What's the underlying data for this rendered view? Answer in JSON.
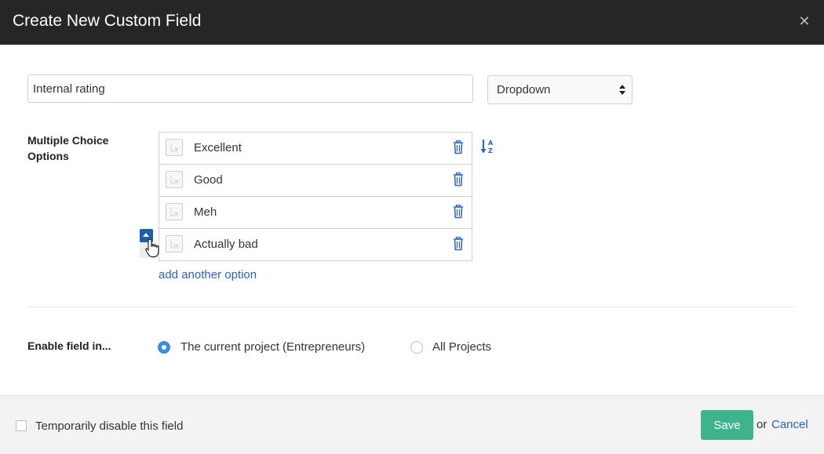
{
  "modal": {
    "title": "Create New Custom Field",
    "close_icon": "close-icon",
    "close_glyph": "✕"
  },
  "field": {
    "name_value": "Internal rating",
    "type_selected": "Dropdown"
  },
  "options_section": {
    "label": "Multiple Choice Options",
    "options": [
      {
        "label": "Excellent"
      },
      {
        "label": "Good"
      },
      {
        "label": "Meh"
      },
      {
        "label": "Actually bad"
      }
    ],
    "add_link": "add another option",
    "icons": {
      "drag": "drag-handle-icon",
      "delete": "trash-icon",
      "sort": "sort-az-icon",
      "reorder": "move-up-icon",
      "cursor": "hand-pointer-icon"
    }
  },
  "enable": {
    "label": "Enable field in...",
    "options": [
      {
        "label": "The current project (Entrepreneurs)",
        "selected": true
      },
      {
        "label": "All Projects",
        "selected": false
      }
    ]
  },
  "footer": {
    "disable_label": "Temporarily disable this field",
    "disable_checked": false,
    "save_label": "Save",
    "or_text": "or",
    "cancel_label": "Cancel"
  },
  "colors": {
    "header_bg": "#262626",
    "accent_blue": "#2a64b8",
    "save_green": "#3eb38e",
    "radio_blue": "#3b8be3"
  }
}
